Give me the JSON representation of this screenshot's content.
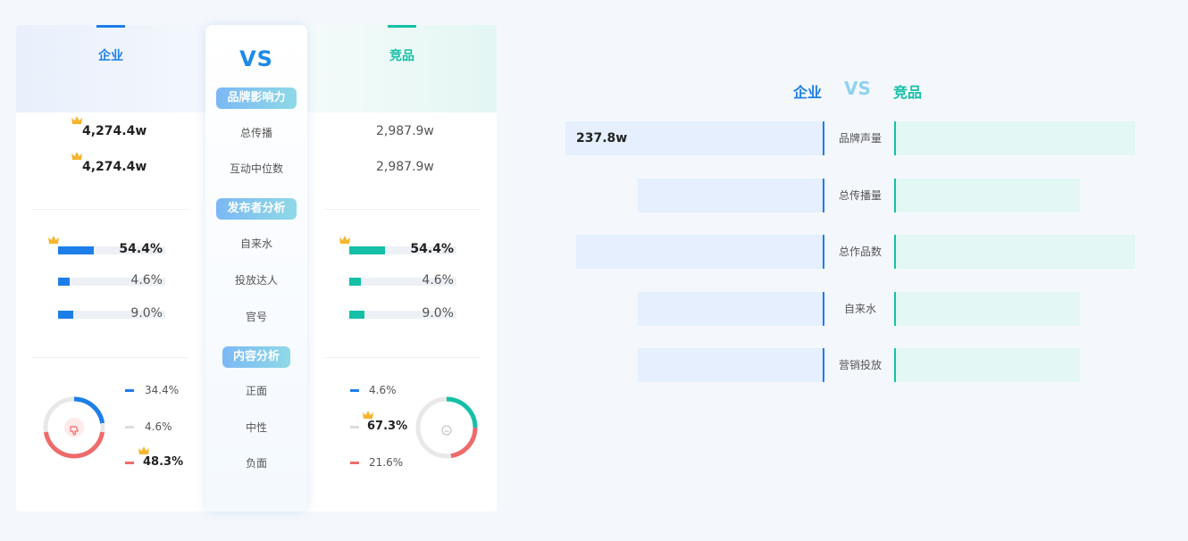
{
  "card": {
    "enterprise_title": "企业",
    "competitor_title": "竞品",
    "vs": "VS",
    "sections": {
      "brand": "品牌影响力",
      "publisher": "发布者分析",
      "content": "内容分析"
    },
    "brand_metrics": [
      {
        "label": "总传播",
        "enterprise": "4,274.4w",
        "competitor": "2,987.9w"
      },
      {
        "label": "互动中位数",
        "enterprise": "4,274.4w",
        "competitor": "2,987.9w"
      }
    ],
    "publisher_metrics": [
      {
        "label": "自来水",
        "enterprise_pct": "54.4%",
        "enterprise_value": 54.4,
        "competitor_pct": "54.4%",
        "competitor_value": 54.4
      },
      {
        "label": "投放达人",
        "enterprise_pct": "4.6%",
        "enterprise_value": 4.6,
        "competitor_pct": "4.6%",
        "competitor_value": 4.6
      },
      {
        "label": "官号",
        "enterprise_pct": "9.0%",
        "enterprise_value": 9.0,
        "competitor_pct": "9.0%",
        "competitor_value": 9.0
      }
    ],
    "content_metrics": [
      {
        "label": "正面",
        "enterprise": "34.4%",
        "competitor": "4.6%"
      },
      {
        "label": "中性",
        "enterprise": "4.6%",
        "competitor": "67.3%"
      },
      {
        "label": "负面",
        "enterprise": "48.3%",
        "competitor": "21.6%"
      }
    ]
  },
  "colors": {
    "enterprise": "#1d7ee8",
    "competitor": "#14c0a6",
    "positive": "#1d7ee8",
    "neutral": "#dddddd",
    "negative": "#ef6b6b",
    "crown": "#f5b52e"
  },
  "icons": {
    "enterprise_donut_center": "thumbs-down-icon",
    "competitor_donut_center": "neutral-face-icon",
    "winner": "crown-icon"
  },
  "chart_data": {
    "type": "bar",
    "legend": {
      "enterprise": "企业",
      "vs": "VS",
      "competitor": "竞品"
    },
    "categories": [
      "品牌声量",
      "总传播量",
      "总作品数",
      "自来水",
      "营销投放"
    ],
    "series": [
      {
        "name": "企业",
        "values": [
          100,
          72,
          96,
          72,
          72
        ]
      },
      {
        "name": "竞品",
        "values": [
          100,
          77,
          100,
          77,
          77
        ]
      }
    ],
    "data_labels": [
      "237.8w",
      "",
      "",
      "",
      ""
    ]
  }
}
